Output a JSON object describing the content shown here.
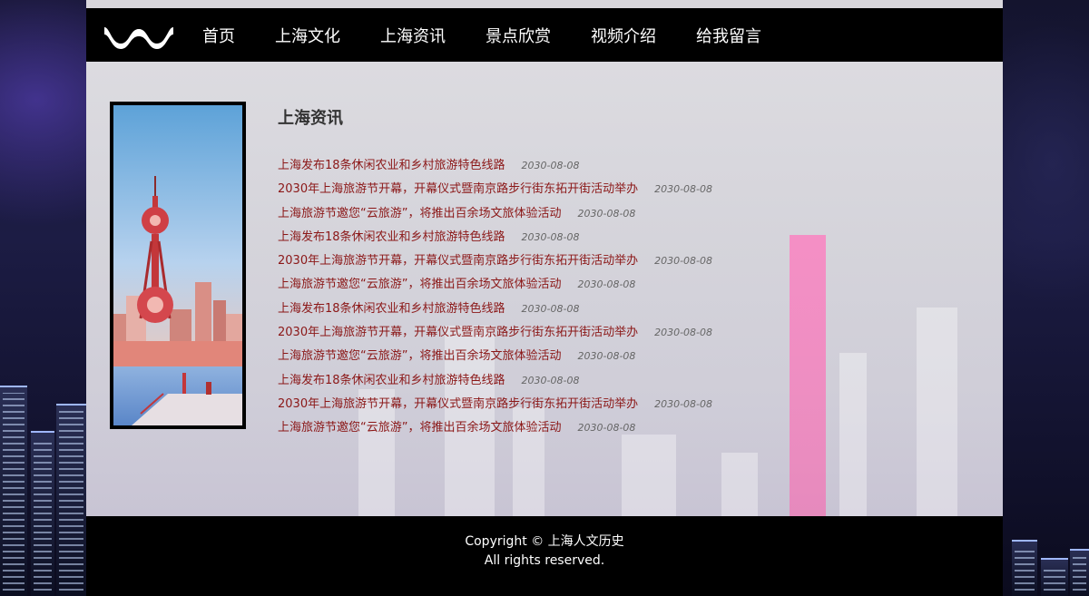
{
  "nav": {
    "items": [
      {
        "label": "首页"
      },
      {
        "label": "上海文化"
      },
      {
        "label": "上海资讯"
      },
      {
        "label": "景点欣赏"
      },
      {
        "label": "视频介绍"
      },
      {
        "label": "给我留言"
      }
    ]
  },
  "news": {
    "title": "上海资讯",
    "items": [
      {
        "title": "上海发布18条休闲农业和乡村旅游特色线路",
        "date": "2030-08-08"
      },
      {
        "title": "2030年上海旅游节开幕，开幕仪式暨南京路步行街东拓开街活动举办",
        "date": "2030-08-08"
      },
      {
        "title": "上海旅游节邀您“云旅游”，将推出百余场文旅体验活动",
        "date": "2030-08-08"
      },
      {
        "title": "上海发布18条休闲农业和乡村旅游特色线路",
        "date": "2030-08-08"
      },
      {
        "title": "2030年上海旅游节开幕，开幕仪式暨南京路步行街东拓开街活动举办",
        "date": "2030-08-08"
      },
      {
        "title": "上海旅游节邀您“云旅游”，将推出百余场文旅体验活动",
        "date": "2030-08-08"
      },
      {
        "title": "上海发布18条休闲农业和乡村旅游特色线路",
        "date": "2030-08-08"
      },
      {
        "title": "2030年上海旅游节开幕，开幕仪式暨南京路步行街东拓开街活动举办",
        "date": "2030-08-08"
      },
      {
        "title": "上海旅游节邀您“云旅游”，将推出百余场文旅体验活动",
        "date": "2030-08-08"
      },
      {
        "title": "上海发布18条休闲农业和乡村旅游特色线路",
        "date": "2030-08-08"
      },
      {
        "title": "2030年上海旅游节开幕，开幕仪式暨南京路步行街东拓开街活动举办",
        "date": "2030-08-08"
      },
      {
        "title": "上海旅游节邀您“云旅游”，将推出百余场文旅体验活动",
        "date": "2030-08-08"
      }
    ]
  },
  "footer": {
    "copyright": "Copyright © 上海人文历史",
    "rights": "All rights reserved."
  },
  "colors": {
    "nav_bg": "#000000",
    "news_link": "#8b1717",
    "news_date": "#666666",
    "footer_bg": "#000000"
  },
  "icons": {
    "logo": "wave-logo-icon"
  }
}
